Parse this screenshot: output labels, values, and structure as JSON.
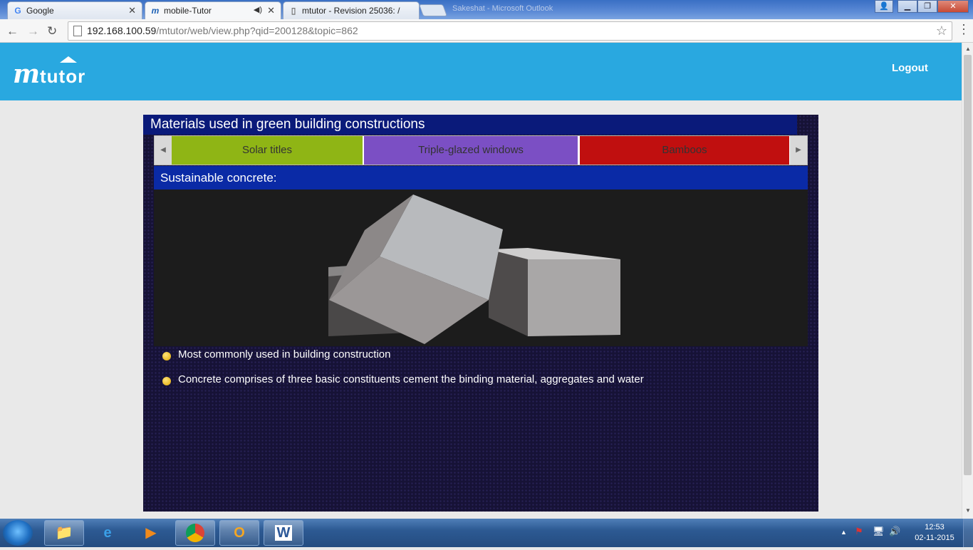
{
  "browser": {
    "tabs": [
      {
        "title": "Google",
        "icon": "google-icon"
      },
      {
        "title": "mobile-Tutor",
        "icon": "mtutor-icon",
        "audio": true
      },
      {
        "title": "mtutor - Revision 25036: /",
        "icon": "page-icon"
      }
    ],
    "background_window_title": "Sakeshat - Microsoft Outlook",
    "url_host": "192.168.100.59",
    "url_path": "/mtutor/web/view.php?qid=200128&topic=862"
  },
  "site": {
    "logo_text": "mtutor",
    "logout_label": "Logout",
    "header_color": "#29a8e0"
  },
  "lesson": {
    "title": "Materials used in green building constructions",
    "topic_tabs": [
      {
        "label": "Solar titles",
        "color": "#8fb515"
      },
      {
        "label": "Triple-glazed windows",
        "color": "#7b4fc4"
      },
      {
        "label": "Bamboos",
        "color": "#c00f0f"
      }
    ],
    "section_heading": "Sustainable concrete:",
    "bullets": [
      "Most commonly used in building construction",
      "Concrete comprises of three basic constituents cement the binding material, aggregates and water"
    ]
  },
  "taskbar": {
    "time": "12:53",
    "date": "02-11-2015",
    "apps": [
      "explorer-icon",
      "internet-explorer-icon",
      "media-player-icon",
      "chrome-icon",
      "outlook-icon",
      "word-icon"
    ]
  }
}
